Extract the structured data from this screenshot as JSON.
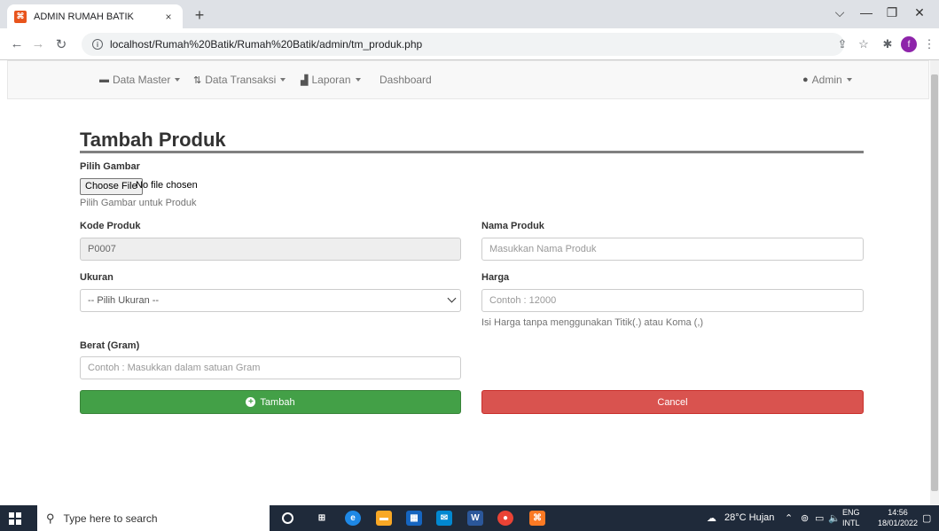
{
  "browser": {
    "tab_title": "ADMIN RUMAH BATIK",
    "tab_close": "×",
    "new_tab": "+",
    "url": "localhost/Rumah%20Batik/Rumah%20Batik/admin/tm_produk.php",
    "profile_initial": "f",
    "window_controls": [
      "⌵",
      "—",
      "❐",
      "✕"
    ]
  },
  "navbar": {
    "items": [
      {
        "label": "Data Master",
        "icon": "inbox-icon",
        "dropdown": true
      },
      {
        "label": "Data Transaksi",
        "icon": "transfer-icon",
        "dropdown": true
      },
      {
        "label": "Laporan",
        "icon": "bar-chart-icon",
        "dropdown": true
      },
      {
        "label": "Dashboard",
        "icon": "",
        "dropdown": false
      }
    ],
    "user": {
      "label": "Admin",
      "icon": "user-icon"
    }
  },
  "form": {
    "title": "Tambah Produk",
    "image": {
      "label": "Pilih Gambar",
      "button": "Choose File",
      "status": "No file chosen",
      "help": "Pilih Gambar untuk Produk"
    },
    "kode": {
      "label": "Kode Produk",
      "value": "P0007"
    },
    "nama": {
      "label": "Nama Produk",
      "placeholder": "Masukkan Nama Produk"
    },
    "ukuran": {
      "label": "Ukuran",
      "selected": "-- Pilih Ukuran --"
    },
    "harga": {
      "label": "Harga",
      "placeholder": "Contoh : 12000",
      "help": "Isi Harga tanpa menggunakan Titik(.) atau Koma (,)"
    },
    "berat": {
      "label": "Berat (Gram)",
      "placeholder": "Contoh : Masukkan dalam satuan Gram"
    },
    "submit_label": "Tambah",
    "cancel_label": "Cancel"
  },
  "taskbar": {
    "search_placeholder": "Type here to search",
    "weather": "28°C  Hujan",
    "lang_top": "ENG",
    "lang_bottom": "INTL",
    "time": "14:56",
    "date": "18/01/2022"
  },
  "colors": {
    "success": "#43a047",
    "danger": "#d9534f",
    "navbar_bg": "#f8f8f8"
  }
}
